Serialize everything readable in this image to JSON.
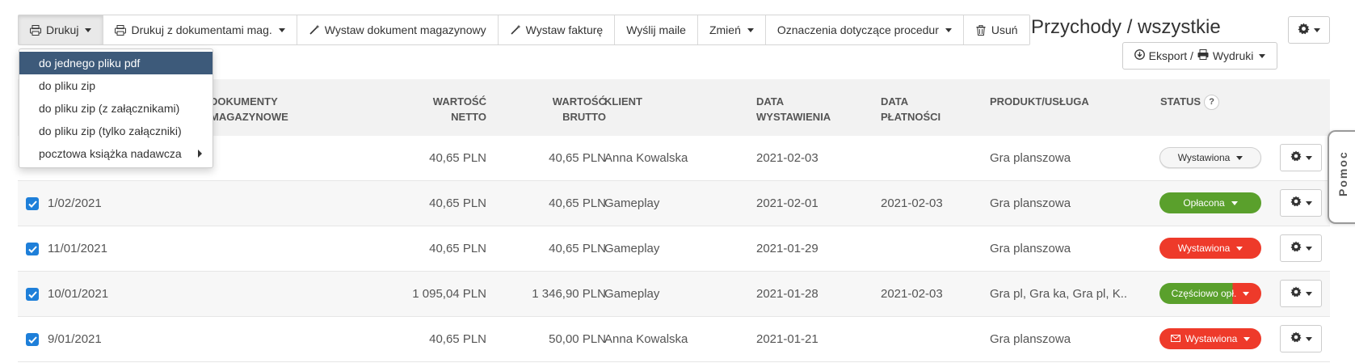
{
  "toolbar": {
    "print": "Drukuj",
    "print_with_docs": "Drukuj z dokumentami mag.",
    "issue_warehouse_doc": "Wystaw dokument magazynowy",
    "issue_invoice": "Wystaw fakturę",
    "send_mails": "Wyślij maile",
    "change": "Zmień",
    "procedure_markings": "Oznaczenia dotyczące procedur",
    "delete": "Usuń"
  },
  "page_title": "Przychody / wszystkie",
  "export_button": "Eksport / ",
  "prints_button": "Wydruki",
  "print_menu": {
    "items": [
      {
        "label": "do jednego pliku pdf"
      },
      {
        "label": "do pliku zip"
      },
      {
        "label": "do pliku zip (z załącznikami)"
      },
      {
        "label": "do pliku zip (tylko załączniki)"
      },
      {
        "label": "pocztowa książka nadawcza"
      }
    ]
  },
  "table": {
    "headers": {
      "documents_line1": "DOKUMENTY",
      "documents_line2": "MAGAZYNOWE",
      "net_line1": "WARTOŚĆ",
      "net_line2": "NETTO",
      "gross_line1": "WARTOŚĆ",
      "gross_line2": "BRUTTO",
      "client": "KLIENT",
      "issue_date_line1": "DATA",
      "issue_date_line2": "WYSTAWIENIA",
      "payment_date_line1": "DATA",
      "payment_date_line2": "PŁATNOŚCI",
      "product": "PRODUKT/USŁUGA",
      "status": "STATUS",
      "status_help": "?"
    },
    "rows": [
      {
        "number": "",
        "net": "40,65 PLN",
        "gross": "40,65 PLN",
        "client": "Anna Kowalska",
        "issue_date": "2021-02-03",
        "payment_date": "",
        "product": "Gra planszowa",
        "status": "Wystawiona"
      },
      {
        "number": "1/02/2021",
        "net": "40,65 PLN",
        "gross": "40,65 PLN",
        "client": "Gameplay",
        "issue_date": "2021-02-01",
        "payment_date": "2021-02-03",
        "product": "Gra planszowa",
        "status": "Opłacona"
      },
      {
        "number": "11/01/2021",
        "net": "40,65 PLN",
        "gross": "40,65 PLN",
        "client": "Gameplay",
        "issue_date": "2021-01-29",
        "payment_date": "",
        "product": "Gra planszowa",
        "status": "Wystawiona"
      },
      {
        "number": "10/01/2021",
        "net": "1 095,04 PLN",
        "gross": "1 346,90 PLN",
        "client": "Gameplay",
        "issue_date": "2021-01-28",
        "payment_date": "2021-02-03",
        "product": "Gra pl, Gra ka, Gra pl, K..",
        "status": "Częściowo opł."
      },
      {
        "number": "9/01/2021",
        "net": "40,65 PLN",
        "gross": "50,00 PLN",
        "client": "Anna Kowalska",
        "issue_date": "2021-01-21",
        "payment_date": "",
        "product": "Gra planszowa",
        "status": "Wystawiona"
      }
    ]
  },
  "help_tab": "Pomoc",
  "colors": {
    "selected_menu": "#3d5a7a",
    "status_green": "#5aa02c",
    "status_red": "#ee3a2a",
    "checkbox": "#1e7fd9"
  }
}
